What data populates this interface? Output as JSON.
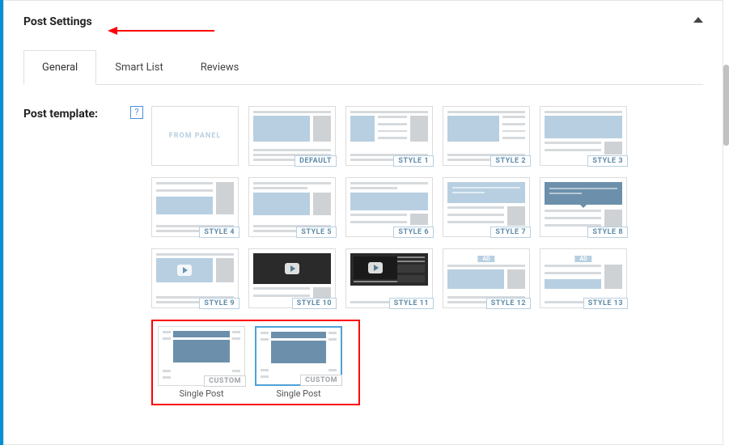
{
  "panel": {
    "title": "Post Settings"
  },
  "tabs": {
    "general": "General",
    "smart_list": "Smart List",
    "reviews": "Reviews"
  },
  "post_template": {
    "label": "Post template:",
    "help": "?",
    "cards": {
      "from_panel": "FROM PANEL",
      "default": "DEFAULT",
      "style1": "STYLE 1",
      "style2": "STYLE 2",
      "style3": "STYLE 3",
      "style4": "STYLE 4",
      "style5": "STYLE 5",
      "style6": "STYLE 6",
      "style7": "STYLE 7",
      "style8": "STYLE 8",
      "style9": "STYLE 9",
      "style10": "STYLE 10",
      "style11": "STYLE 11",
      "style12": "STYLE 12",
      "style13": "STYLE 13",
      "ad": "AD",
      "custom": "CUSTOM",
      "caption1": "Single Post",
      "caption2": "Single Post"
    }
  }
}
